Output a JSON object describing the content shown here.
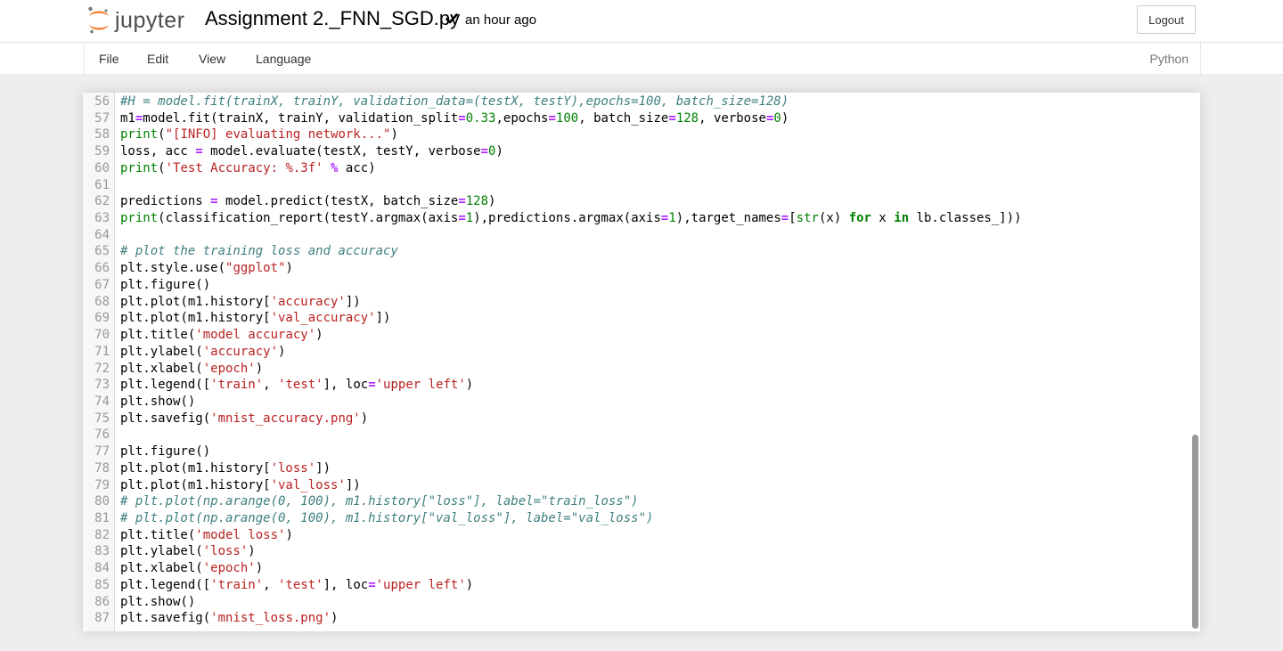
{
  "header": {
    "logo_text": "jupyter",
    "notebook_name": "Assignment 2._FNN_SGD.py",
    "last_saved": "an hour ago",
    "logout_label": "Logout"
  },
  "menu": {
    "items": [
      "File",
      "Edit",
      "View",
      "Language"
    ],
    "kernel": "Python"
  },
  "colors": {
    "comment": "#408080",
    "string": "#BA2121",
    "number": "#008000",
    "operator": "#AA22FF",
    "keyword": "#008000",
    "logo_orange": "#F37726"
  },
  "editor": {
    "lines": [
      {
        "n": "56",
        "tokens": [
          [
            "cm",
            "#H = model.fit(trainX, trainY, validation_data=(testX, testY),epochs=100, batch_size=128)"
          ]
        ]
      },
      {
        "n": "57",
        "tokens": [
          [
            "",
            "m1"
          ],
          [
            "op",
            "="
          ],
          [
            "",
            "model.fit(trainX, trainY, validation_split"
          ],
          [
            "op",
            "="
          ],
          [
            "num",
            "0.33"
          ],
          [
            "",
            ",epochs"
          ],
          [
            "op",
            "="
          ],
          [
            "num",
            "100"
          ],
          [
            "",
            ", batch_size"
          ],
          [
            "op",
            "="
          ],
          [
            "num",
            "128"
          ],
          [
            "",
            ", verbose"
          ],
          [
            "op",
            "="
          ],
          [
            "num",
            "0"
          ],
          [
            "",
            ")"
          ]
        ]
      },
      {
        "n": "58",
        "tokens": [
          [
            "bi",
            "print"
          ],
          [
            "",
            "("
          ],
          [
            "str",
            "\"[INFO] evaluating network...\""
          ],
          [
            "",
            ")"
          ]
        ]
      },
      {
        "n": "59",
        "tokens": [
          [
            "",
            "loss, acc "
          ],
          [
            "op",
            "="
          ],
          [
            "",
            " model.evaluate(testX, testY, verbose"
          ],
          [
            "op",
            "="
          ],
          [
            "num",
            "0"
          ],
          [
            "",
            ")"
          ]
        ]
      },
      {
        "n": "60",
        "tokens": [
          [
            "bi",
            "print"
          ],
          [
            "",
            "("
          ],
          [
            "str",
            "'Test Accuracy: %.3f'"
          ],
          [
            "",
            " "
          ],
          [
            "op",
            "%"
          ],
          [
            "",
            " acc)"
          ]
        ]
      },
      {
        "n": "61",
        "tokens": []
      },
      {
        "n": "62",
        "tokens": [
          [
            "",
            "predictions "
          ],
          [
            "op",
            "="
          ],
          [
            "",
            " model.predict(testX, batch_size"
          ],
          [
            "op",
            "="
          ],
          [
            "num",
            "128"
          ],
          [
            "",
            ")"
          ]
        ]
      },
      {
        "n": "63",
        "tokens": [
          [
            "bi",
            "print"
          ],
          [
            "",
            "(classification_report(testY.argmax(axis"
          ],
          [
            "op",
            "="
          ],
          [
            "num",
            "1"
          ],
          [
            "",
            "),predictions.argmax(axis"
          ],
          [
            "op",
            "="
          ],
          [
            "num",
            "1"
          ],
          [
            "",
            "),target_names"
          ],
          [
            "op",
            "="
          ],
          [
            "",
            "["
          ],
          [
            "bi",
            "str"
          ],
          [
            "",
            "(x) "
          ],
          [
            "kw",
            "for"
          ],
          [
            "",
            " x "
          ],
          [
            "kw",
            "in"
          ],
          [
            "",
            " lb.classes_]))"
          ]
        ]
      },
      {
        "n": "64",
        "tokens": []
      },
      {
        "n": "65",
        "tokens": [
          [
            "cm",
            "# plot the training loss and accuracy"
          ]
        ]
      },
      {
        "n": "66",
        "tokens": [
          [
            "",
            "plt.style.use("
          ],
          [
            "str",
            "\"ggplot\""
          ],
          [
            "",
            ")"
          ]
        ]
      },
      {
        "n": "67",
        "tokens": [
          [
            "",
            "plt.figure()"
          ]
        ]
      },
      {
        "n": "68",
        "tokens": [
          [
            "",
            "plt.plot(m1.history["
          ],
          [
            "str",
            "'accuracy'"
          ],
          [
            "",
            "])"
          ]
        ]
      },
      {
        "n": "69",
        "tokens": [
          [
            "",
            "plt.plot(m1.history["
          ],
          [
            "str",
            "'val_accuracy'"
          ],
          [
            "",
            "])"
          ]
        ]
      },
      {
        "n": "70",
        "tokens": [
          [
            "",
            "plt.title("
          ],
          [
            "str",
            "'model accuracy'"
          ],
          [
            "",
            ")"
          ]
        ]
      },
      {
        "n": "71",
        "tokens": [
          [
            "",
            "plt.ylabel("
          ],
          [
            "str",
            "'accuracy'"
          ],
          [
            "",
            ")"
          ]
        ]
      },
      {
        "n": "72",
        "tokens": [
          [
            "",
            "plt.xlabel("
          ],
          [
            "str",
            "'epoch'"
          ],
          [
            "",
            ")"
          ]
        ]
      },
      {
        "n": "73",
        "tokens": [
          [
            "",
            "plt.legend(["
          ],
          [
            "str",
            "'train'"
          ],
          [
            "",
            ", "
          ],
          [
            "str",
            "'test'"
          ],
          [
            "",
            "], loc"
          ],
          [
            "op",
            "="
          ],
          [
            "str",
            "'upper left'"
          ],
          [
            "",
            ")"
          ]
        ]
      },
      {
        "n": "74",
        "tokens": [
          [
            "",
            "plt.show()"
          ]
        ]
      },
      {
        "n": "75",
        "tokens": [
          [
            "",
            "plt.savefig("
          ],
          [
            "str",
            "'mnist_accuracy.png'"
          ],
          [
            "",
            ")"
          ]
        ]
      },
      {
        "n": "76",
        "tokens": []
      },
      {
        "n": "77",
        "tokens": [
          [
            "",
            "plt.figure()"
          ]
        ]
      },
      {
        "n": "78",
        "tokens": [
          [
            "",
            "plt.plot(m1.history["
          ],
          [
            "str",
            "'loss'"
          ],
          [
            "",
            "])"
          ]
        ]
      },
      {
        "n": "79",
        "tokens": [
          [
            "",
            "plt.plot(m1.history["
          ],
          [
            "str",
            "'val_loss'"
          ],
          [
            "",
            "])"
          ]
        ]
      },
      {
        "n": "80",
        "tokens": [
          [
            "cm",
            "# plt.plot(np.arange(0, 100), m1.history[\"loss\"], label=\"train_loss\")"
          ]
        ]
      },
      {
        "n": "81",
        "tokens": [
          [
            "cm",
            "# plt.plot(np.arange(0, 100), m1.history[\"val_loss\"], label=\"val_loss\")"
          ]
        ]
      },
      {
        "n": "82",
        "tokens": [
          [
            "",
            "plt.title("
          ],
          [
            "str",
            "'model loss'"
          ],
          [
            "",
            ")"
          ]
        ]
      },
      {
        "n": "83",
        "tokens": [
          [
            "",
            "plt.ylabel("
          ],
          [
            "str",
            "'loss'"
          ],
          [
            "",
            ")"
          ]
        ]
      },
      {
        "n": "84",
        "tokens": [
          [
            "",
            "plt.xlabel("
          ],
          [
            "str",
            "'epoch'"
          ],
          [
            "",
            ")"
          ]
        ]
      },
      {
        "n": "85",
        "tokens": [
          [
            "",
            "plt.legend(["
          ],
          [
            "str",
            "'train'"
          ],
          [
            "",
            ", "
          ],
          [
            "str",
            "'test'"
          ],
          [
            "",
            "], loc"
          ],
          [
            "op",
            "="
          ],
          [
            "str",
            "'upper left'"
          ],
          [
            "",
            ")"
          ]
        ]
      },
      {
        "n": "86",
        "tokens": [
          [
            "",
            "plt.show()"
          ]
        ]
      },
      {
        "n": "87",
        "tokens": [
          [
            "",
            "plt.savefig("
          ],
          [
            "str",
            "'mnist_loss.png'"
          ],
          [
            "",
            ")"
          ]
        ]
      }
    ]
  }
}
